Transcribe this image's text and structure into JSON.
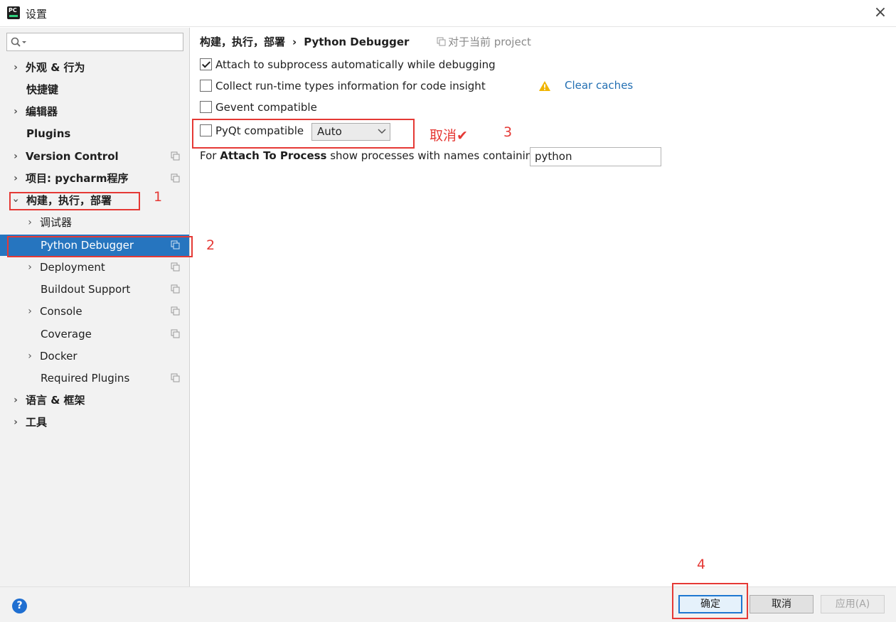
{
  "window": {
    "title": "设置",
    "app_icon_text": "PC",
    "close_glyph": "×"
  },
  "sidebar": {
    "search_placeholder": "",
    "items": [
      {
        "label": "外观 & 行为",
        "expandable": true
      },
      {
        "label": "快捷键",
        "expandable": false
      },
      {
        "label": "编辑器",
        "expandable": true
      },
      {
        "label": "Plugins",
        "expandable": false
      },
      {
        "label": "Version Control",
        "expandable": true
      },
      {
        "label": "项目: pycharm程序",
        "expandable": true
      },
      {
        "label": "构建，执行，部署",
        "expandable": true,
        "expanded": true
      },
      {
        "label": "调试器",
        "expandable": true
      },
      {
        "label": "Python Debugger",
        "expandable": false,
        "selected": true
      },
      {
        "label": "Deployment",
        "expandable": true
      },
      {
        "label": "Buildout Support",
        "expandable": false
      },
      {
        "label": "Console",
        "expandable": true
      },
      {
        "label": "Coverage",
        "expandable": false
      },
      {
        "label": "Docker",
        "expandable": true
      },
      {
        "label": "Required Plugins",
        "expandable": false
      },
      {
        "label": "语言 & 框架",
        "expandable": true
      },
      {
        "label": "工具",
        "expandable": true
      }
    ]
  },
  "main": {
    "breadcrumb_parent": "构建，执行，部署",
    "breadcrumb_sep": "›",
    "breadcrumb_current": "Python Debugger",
    "scope_note": "对于当前 project",
    "options": {
      "attach_subprocess": {
        "label": "Attach to subprocess automatically while debugging",
        "checked": true
      },
      "collect_types": {
        "label": "Collect run-time types information for code insight",
        "checked": false
      },
      "gevent": {
        "label": "Gevent compatible",
        "checked": false
      },
      "pyqt": {
        "label": "PyQt compatible",
        "checked": false,
        "selected_value": "Auto"
      }
    },
    "clear_caches": "Clear caches",
    "process_label_prefix": "For ",
    "process_label_bold": "Attach To Process",
    "process_label_suffix": " show processes with names containing:",
    "process_value": "python"
  },
  "annotations": {
    "n1": "1",
    "n2": "2",
    "n3": "3",
    "n4": "4",
    "cancel_text": "取消",
    "check_glyph": "✔"
  },
  "footer": {
    "help": "?",
    "ok": "确定",
    "cancel": "取消",
    "apply": "应用(A)"
  },
  "colors": {
    "selection": "#2675bf",
    "link": "#2470b3",
    "annotation": "#e53935",
    "warning": "#f0b400"
  }
}
